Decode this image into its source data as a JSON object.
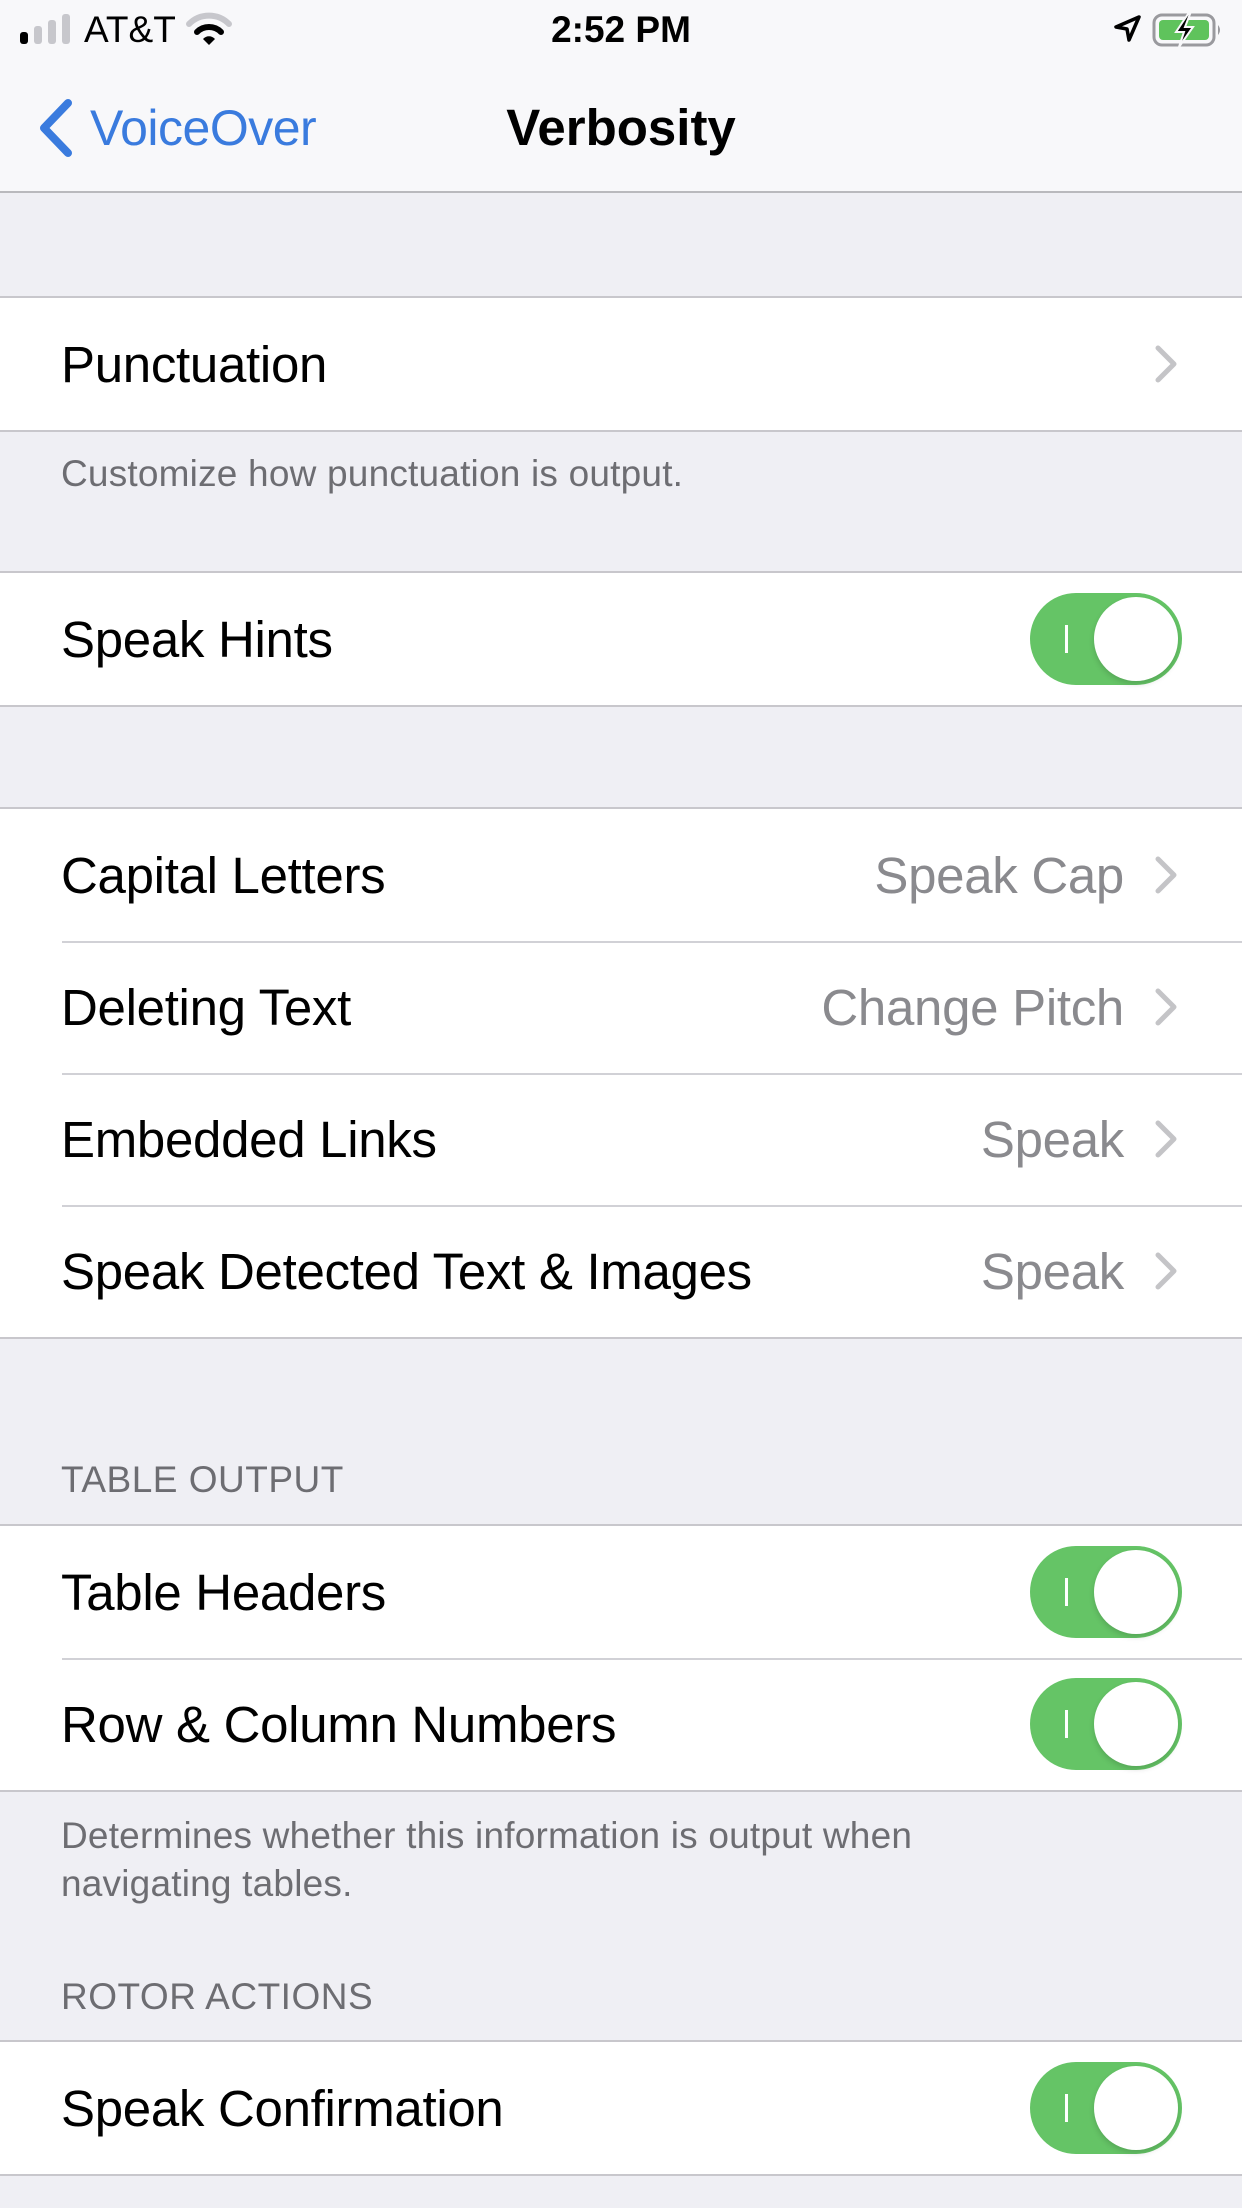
{
  "status_bar": {
    "carrier": "AT&T",
    "time": "2:52 PM",
    "signal_bars_filled": 1,
    "signal_bars_total": 4,
    "wifi_icon": "wifi-icon",
    "location_icon": "location-arrow-icon",
    "battery_icon": "battery-charging-icon",
    "battery_charging": true
  },
  "nav": {
    "back_label": "VoiceOver",
    "back_icon": "chevron-left-icon",
    "title": "Verbosity"
  },
  "colors": {
    "accent": "#3A7BDE",
    "toggle_on": "#65C466",
    "background": "#EFEFF4",
    "secondary_text": "#6D6D72",
    "value_text": "#8A8A8E"
  },
  "sections": [
    {
      "rows": [
        {
          "label": "Punctuation",
          "type": "disclosure"
        }
      ],
      "footer": "Customize how punctuation is output."
    },
    {
      "rows": [
        {
          "label": "Speak Hints",
          "type": "toggle",
          "on": true
        }
      ]
    },
    {
      "rows": [
        {
          "label": "Capital Letters",
          "value": "Speak Cap",
          "type": "disclosure"
        },
        {
          "label": "Deleting Text",
          "value": "Change Pitch",
          "type": "disclosure"
        },
        {
          "label": "Embedded Links",
          "value": "Speak",
          "type": "disclosure"
        },
        {
          "label": "Speak Detected Text & Images",
          "value": "Speak",
          "type": "disclosure"
        }
      ]
    },
    {
      "header": "TABLE OUTPUT",
      "rows": [
        {
          "label": "Table Headers",
          "type": "toggle",
          "on": true
        },
        {
          "label": "Row & Column Numbers",
          "type": "toggle",
          "on": true
        }
      ],
      "footer": "Determines whether this information is output when navigating tables."
    },
    {
      "header": "ROTOR ACTIONS",
      "rows": [
        {
          "label": "Speak Confirmation",
          "type": "toggle",
          "on": true
        }
      ]
    }
  ]
}
